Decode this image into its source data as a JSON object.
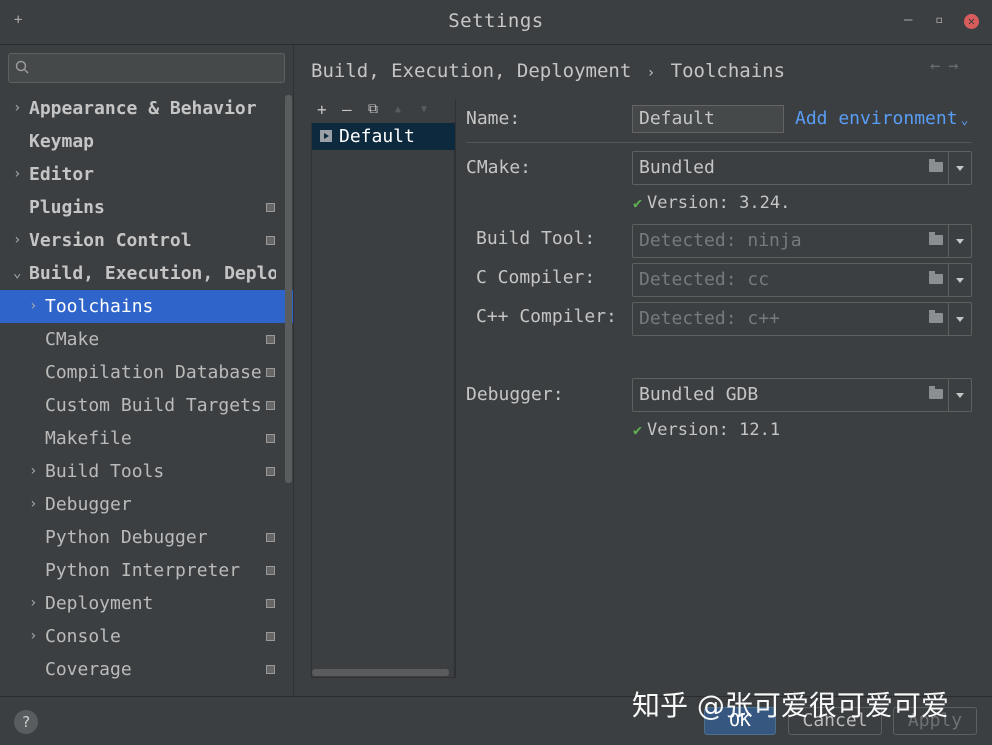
{
  "window": {
    "title": "Settings",
    "pin_icon": "+",
    "minimize_icon": "–",
    "maximize_icon": "▫",
    "close_icon": "✕"
  },
  "sidebar": {
    "search": {
      "placeholder": ""
    },
    "items": [
      {
        "label": "Appearance & Behavior",
        "arrow": "›",
        "bold": true,
        "project": false
      },
      {
        "label": "Keymap",
        "arrow": "",
        "bold": true,
        "project": false
      },
      {
        "label": "Editor",
        "arrow": "›",
        "bold": true,
        "project": false
      },
      {
        "label": "Plugins",
        "arrow": "",
        "bold": true,
        "project": true
      },
      {
        "label": "Version Control",
        "arrow": "›",
        "bold": true,
        "project": true
      },
      {
        "label": "Build, Execution, Deployment",
        "arrow": "⌄",
        "bold": true,
        "project": false
      },
      {
        "label": "Toolchains",
        "arrow": "›",
        "bold": false,
        "project": false,
        "selected": true
      },
      {
        "label": "CMake",
        "arrow": "",
        "bold": false,
        "project": true
      },
      {
        "label": "Compilation Database",
        "arrow": "",
        "bold": false,
        "project": true
      },
      {
        "label": "Custom Build Targets",
        "arrow": "",
        "bold": false,
        "project": true
      },
      {
        "label": "Makefile",
        "arrow": "",
        "bold": false,
        "project": true
      },
      {
        "label": "Build Tools",
        "arrow": "›",
        "bold": false,
        "project": true
      },
      {
        "label": "Debugger",
        "arrow": "›",
        "bold": false,
        "project": false
      },
      {
        "label": "Python Debugger",
        "arrow": "",
        "bold": false,
        "project": true
      },
      {
        "label": "Python Interpreter",
        "arrow": "",
        "bold": false,
        "project": true
      },
      {
        "label": "Deployment",
        "arrow": "›",
        "bold": false,
        "project": true
      },
      {
        "label": "Console",
        "arrow": "›",
        "bold": false,
        "project": true
      },
      {
        "label": "Coverage",
        "arrow": "",
        "bold": false,
        "project": true
      }
    ]
  },
  "breadcrumb": {
    "parent": "Build, Execution, Deployment",
    "separator": "›",
    "current": "Toolchains",
    "back": "←",
    "forward": "→"
  },
  "toolchain_list": {
    "toolbar": {
      "add": "+",
      "remove": "–",
      "copy": "⧉",
      "up": "▲",
      "down": "▼"
    },
    "items": [
      "Default"
    ]
  },
  "form": {
    "name_label": "Name:",
    "name_value": "Default",
    "add_environment": "Add environment",
    "add_environment_caret": "⌄",
    "cmake_label": "CMake:",
    "cmake_value": "Bundled",
    "cmake_version": "Version: 3.24.",
    "build_tool_label": "Build Tool:",
    "build_tool_value": "Detected: ninja",
    "c_compiler_label": "C Compiler:",
    "c_compiler_value": "Detected: cc",
    "cpp_compiler_label": "C++ Compiler:",
    "cpp_compiler_value": "Detected: c++",
    "debugger_label": "Debugger:",
    "debugger_value": "Bundled GDB",
    "debugger_version": "Version: 12.1",
    "check_mark": "✔"
  },
  "footer": {
    "help": "?",
    "ok": "OK",
    "cancel": "Cancel",
    "apply": "Apply"
  },
  "watermark": "知乎 @张可爱很可爱可爱",
  "colors": {
    "accent": "#2f65ca",
    "link": "#589df6",
    "check": "#5fb052",
    "close": "#d95c5c"
  }
}
